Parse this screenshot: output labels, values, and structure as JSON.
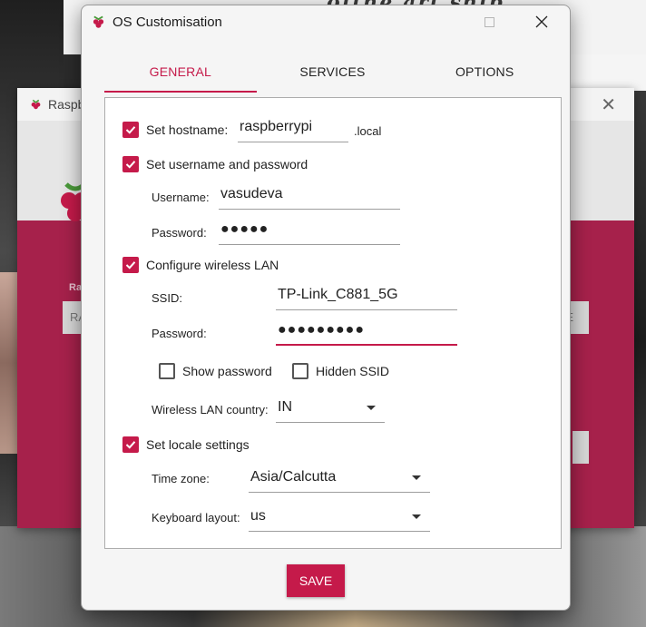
{
  "background": {
    "top_text": "ofthe art ship",
    "rear_window": {
      "title": "Raspb",
      "label": "Ra",
      "button_left": "RA",
      "button_right": "CE"
    }
  },
  "window": {
    "title": "OS Customisation"
  },
  "tabs": [
    {
      "label": "GENERAL",
      "active": true
    },
    {
      "label": "SERVICES",
      "active": false
    },
    {
      "label": "OPTIONS",
      "active": false
    }
  ],
  "general": {
    "hostname": {
      "label": "Set hostname:",
      "checked": true,
      "value": "raspberrypi",
      "suffix": ".local"
    },
    "user": {
      "label": "Set username and password",
      "checked": true,
      "username_label": "Username:",
      "username_value": "vasudeva",
      "password_label": "Password:",
      "password_value": "●●●●●"
    },
    "wlan": {
      "label": "Configure wireless LAN",
      "checked": true,
      "ssid_label": "SSID:",
      "ssid_value": "TP-Link_C881_5G",
      "password_label": "Password:",
      "password_value": "●●●●●●●●●",
      "show_password": {
        "label": "Show password",
        "checked": false
      },
      "hidden_ssid": {
        "label": "Hidden SSID",
        "checked": false
      },
      "country_label": "Wireless LAN country:",
      "country_value": "IN"
    },
    "locale": {
      "label": "Set locale settings",
      "checked": true,
      "timezone_label": "Time zone:",
      "timezone_value": "Asia/Calcutta",
      "keyboard_label": "Keyboard layout:",
      "keyboard_value": "us"
    }
  },
  "actions": {
    "save_label": "SAVE"
  },
  "colors": {
    "accent": "#c51a4a",
    "rear_accent": "#a6214b"
  }
}
